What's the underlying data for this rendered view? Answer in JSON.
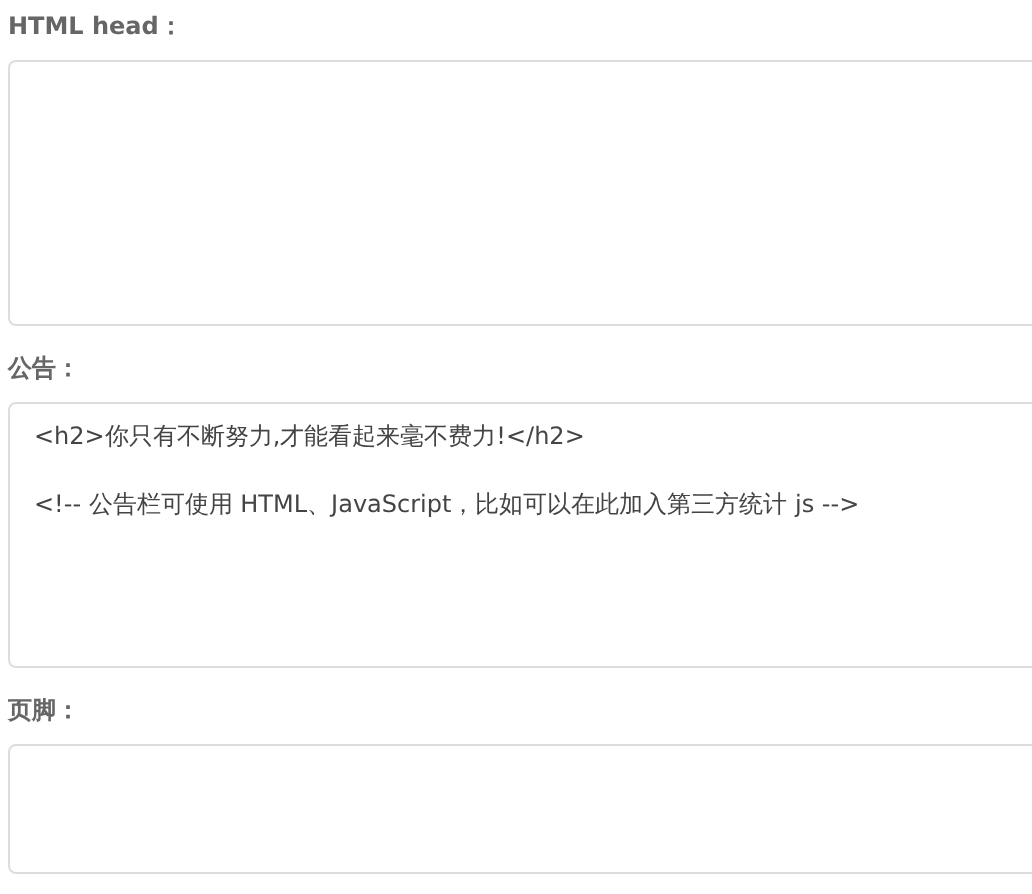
{
  "fields": [
    {
      "label": "HTML head："
    },
    {
      "label": "公告：",
      "value": "<h2>你只有不断努力,才能看起来毫不费力!</h2>\n\n<!-- 公告栏可使用 HTML、JavaScript，比如可以在此加入第三方统计 js -->"
    },
    {
      "label": "页脚："
    }
  ]
}
